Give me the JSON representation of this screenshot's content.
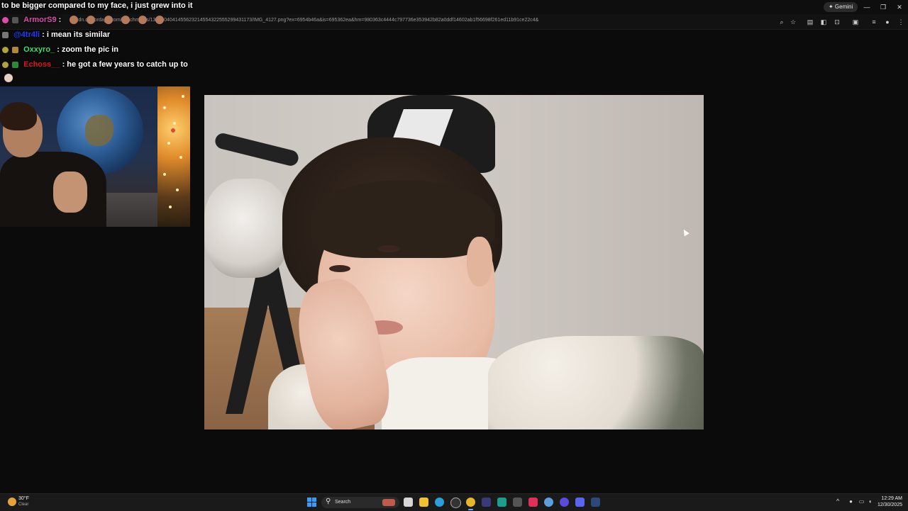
{
  "chat": {
    "top_message": "to be bigger compared to my face, i just grew into it",
    "lines": [
      {
        "user": "ArmorS9",
        "user_color": "#e04bb0",
        "separator": ":",
        "message": ""
      },
      {
        "user": "@4tr4li",
        "user_color": "#1f3fff",
        "separator": ":",
        "message": "i mean its similar"
      },
      {
        "user": "Oxxyro_",
        "user_color": "#39e56b",
        "separator": ":",
        "message": "zoom the pic in"
      },
      {
        "user": "Echoss__",
        "user_color": "#e01616",
        "separator": ":",
        "message": "he got a few years to catch up to"
      }
    ]
  },
  "browser": {
    "url": "cdn.discordapp.com/attachments/1318604041455623214554322555299431173/IMG_4127.png?ex=6954b46a&is=695362ea&hm=980363c4444c797736e353942b82a0ddf14602ab1f56698f261ed11b91ce22c4&",
    "gemini_label": "✦ Gemini",
    "window_controls": [
      "—",
      "❐",
      "✕"
    ]
  },
  "taskbar": {
    "weather_temp": "30°F",
    "weather_condition": "Clear",
    "search_placeholder": "Search",
    "search_glyph": "⚲",
    "clock_time": "12:29 AM",
    "clock_date": "12/30/2025",
    "tray_chevron": "^"
  },
  "colors": {
    "accent": "#3a9bff",
    "background": "#0b0b0b"
  }
}
